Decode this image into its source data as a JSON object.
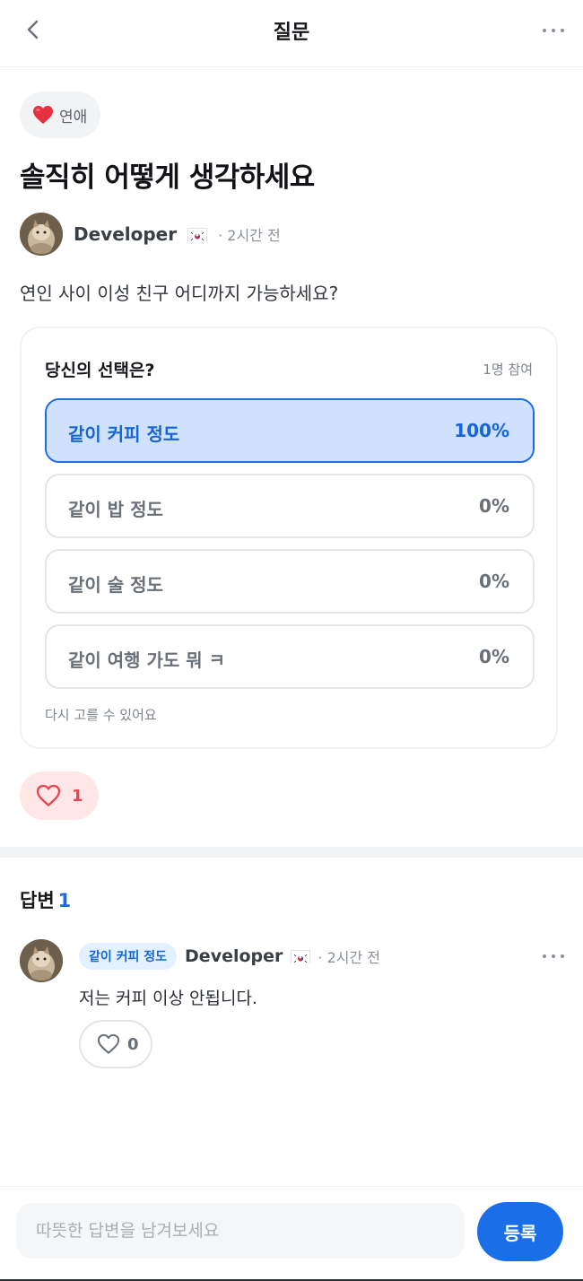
{
  "header": {
    "title": "질문"
  },
  "category": {
    "emoji": "❤️",
    "label": "연애"
  },
  "post": {
    "title": "솔직히 어떻게 생각하세요",
    "author": "Developer",
    "time": "· 2시간 전",
    "body": "연인 사이 이성 친구 어디까지 가능하세요?"
  },
  "poll": {
    "question": "당신의 선택은?",
    "participants": "1명 참여",
    "options": [
      {
        "label": "같이 커피 정도",
        "percent_text": "100%",
        "fraction": 1.0,
        "selected": true
      },
      {
        "label": "같이 밥 정도",
        "percent_text": "0%",
        "fraction": 0,
        "selected": false
      },
      {
        "label": "같이 술 정도",
        "percent_text": "0%",
        "fraction": 0,
        "selected": false
      },
      {
        "label": "같이 여행 가도 뭐 ㅋ",
        "percent_text": "0%",
        "fraction": 0,
        "selected": false
      }
    ],
    "note": "다시 고를 수 있어요"
  },
  "post_like": {
    "count": "1"
  },
  "answers": {
    "heading": "답변",
    "count": "1",
    "items": [
      {
        "choice": "같이 커피 정도",
        "author": "Developer",
        "time": "· 2시간 전",
        "text": "저는 커피 이상 안됩니다.",
        "likes": "0"
      }
    ]
  },
  "composer": {
    "placeholder": "따뜻한 답변을 남겨보세요",
    "submit_label": "등록"
  },
  "colors": {
    "accent": "#1a6fe8",
    "like": "#e8434f",
    "poll_fill": "#cfe1fb"
  },
  "icons": [
    "back-chevron-icon",
    "more-dots-icon",
    "heart-icon",
    "flag-icon"
  ]
}
